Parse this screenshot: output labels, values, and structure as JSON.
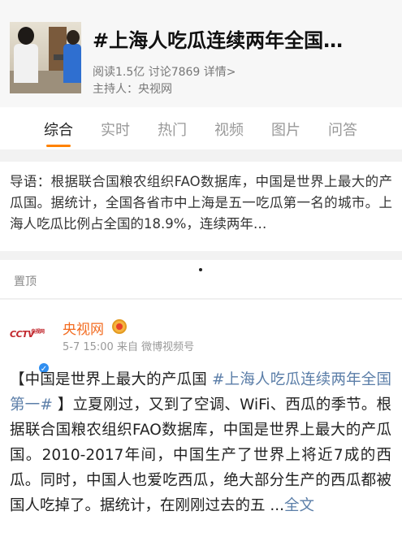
{
  "topic": {
    "title": "#上海人吃瓜连续两年全国…",
    "stats": "阅读1.5亿 讨论7869 详情>",
    "host": "主持人：央视网"
  },
  "tabs": [
    {
      "label": "综合",
      "active": true
    },
    {
      "label": "实时",
      "active": false
    },
    {
      "label": "热门",
      "active": false
    },
    {
      "label": "视频",
      "active": false
    },
    {
      "label": "图片",
      "active": false
    },
    {
      "label": "问答",
      "active": false
    }
  ],
  "intro": {
    "text": "导语：根据联合国粮农组织FAO数据库，中国是世界上最大的产瓜国。据统计，全国各省市中上海是五一吃瓜第一名的城市。上海人吃瓜比例占全国的18.9%，连续两年…"
  },
  "pinned": {
    "label": "置顶"
  },
  "post": {
    "avatar_logo": "CCTV",
    "avatar_logo_sub": "央视网",
    "author": "央视网",
    "meta": "5-7 15:00 来自 微博视频号",
    "body_prefix": "【中国是世界上最大的产瓜国 ",
    "hashtag": "#上海人吃瓜连续两年全国第一#",
    "body_suffix": " 】立夏刚过，又到了空调、WiFi、西瓜的季节。根据联合国粮农组织FAO数据库，中国是世界上最大的产瓜国。2010-2017年间，中国生产了世界上将近7成的西瓜。同时，中国人也爱吃西瓜，绝大部分生产的西瓜都被国人吃掉了。据统计，在刚刚过去的五 ...",
    "more_link": "全文"
  },
  "colors": {
    "accent_orange": "#ff8200",
    "author_orange": "#f36c21",
    "link_blue": "#5b7ea8",
    "verify_blue": "#2f8ef0"
  }
}
